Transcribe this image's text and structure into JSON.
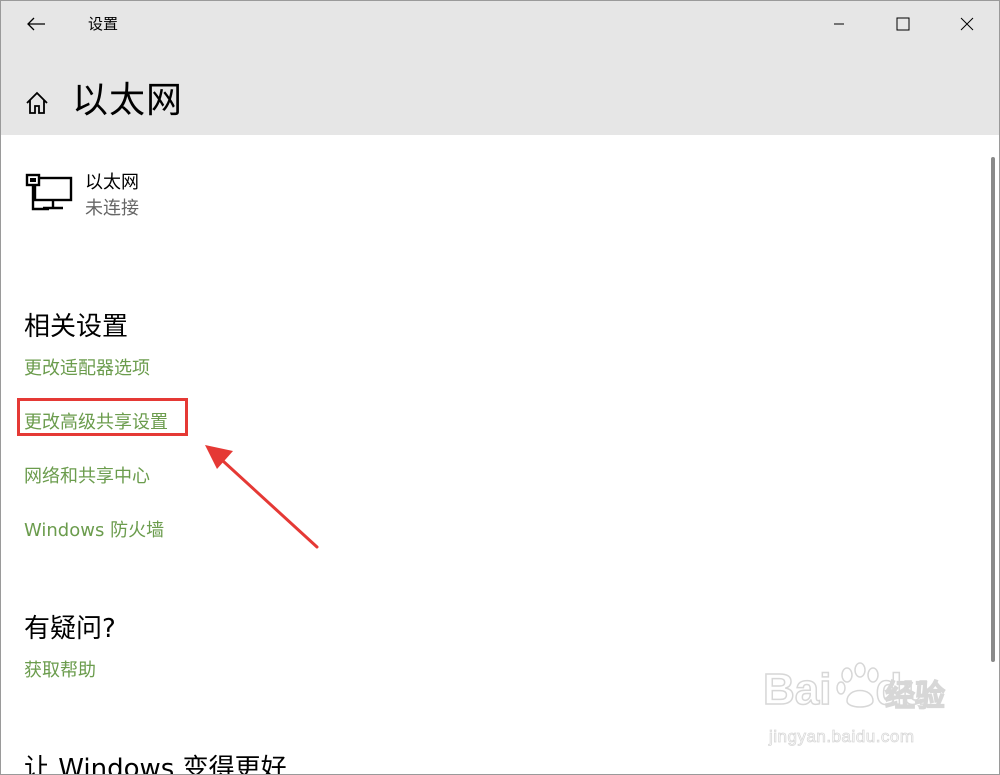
{
  "window": {
    "app_title": "设置",
    "controls": {
      "minimize_icon": "minimize-icon",
      "maximize_icon": "maximize-icon",
      "close_icon": "close-icon"
    }
  },
  "header": {
    "page_title": "以太网",
    "back_icon": "back-arrow-icon",
    "home_icon": "home-icon"
  },
  "connection": {
    "name": "以太网",
    "status": "未连接",
    "icon": "ethernet-network-icon"
  },
  "related_settings": {
    "heading": "相关设置",
    "links": [
      {
        "label": "更改适配器选项"
      },
      {
        "label": "更改高级共享设置",
        "highlighted": true
      },
      {
        "label": "网络和共享中心"
      },
      {
        "label": "Windows 防火墙"
      }
    ]
  },
  "questions": {
    "heading": "有疑问?",
    "links": [
      {
        "label": "获取帮助"
      }
    ]
  },
  "feedback": {
    "heading": "让 Windows 变得更好"
  },
  "watermark": {
    "logo_text": "Bai",
    "logo_text_2": "du",
    "logo_cn": "经验",
    "url": "jingyan.baidu.com"
  },
  "colors": {
    "titlebar_bg": "#e6e6e6",
    "link": "#6b9c4d",
    "highlight_box": "#e53935",
    "annotation_arrow": "#e53935"
  }
}
